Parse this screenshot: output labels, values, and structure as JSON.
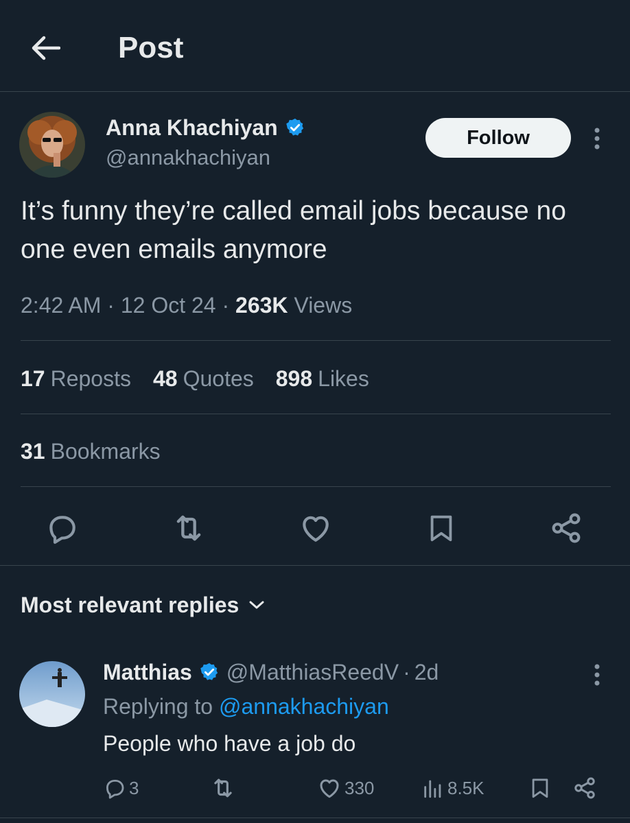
{
  "header": {
    "title": "Post"
  },
  "author": {
    "name": "Anna Khachiyan",
    "handle": "@annakhachiyan",
    "verified": true
  },
  "follow_label": "Follow",
  "post": {
    "text": "It’s funny they’re called email jobs because no one even emails anymore",
    "time": "2:42 AM",
    "date": "12 Oct 24",
    "views_count": "263K",
    "views_label": "Views"
  },
  "stats": {
    "reposts_count": "17",
    "reposts_label": "Reposts",
    "quotes_count": "48",
    "quotes_label": "Quotes",
    "likes_count": "898",
    "likes_label": "Likes",
    "bookmarks_count": "31",
    "bookmarks_label": "Bookmarks"
  },
  "replies_section": {
    "title": "Most relevant replies"
  },
  "reply": {
    "name": "Matthias",
    "verified": true,
    "handle": "@MatthiasReedV",
    "time": "2d",
    "replying_prefix": "Replying to",
    "replying_to": "@annakhachiyan",
    "text": "People who have a job do",
    "replies": "3",
    "likes": "330",
    "views": "8.5K"
  },
  "colors": {
    "background": "#15202b",
    "accent": "#1d9bf0",
    "text": "#e7e9ea",
    "muted": "#8b98a5",
    "border": "#38444d"
  },
  "icons": {
    "back": "arrow-left-icon",
    "verified": "verified-badge-icon",
    "more": "more-vertical-icon",
    "reply": "reply-icon",
    "repost": "repost-icon",
    "like": "heart-icon",
    "bookmark": "bookmark-icon",
    "share": "share-icon",
    "views": "views-icon",
    "chevron": "chevron-down-icon"
  }
}
